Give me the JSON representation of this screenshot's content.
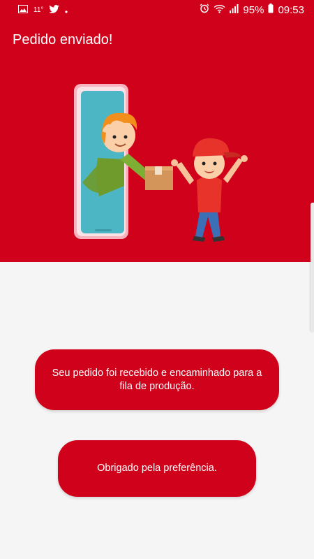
{
  "status_bar": {
    "left_small_text": "11°",
    "battery_percent": "95%",
    "time": "09:53",
    "icons": [
      "gallery-icon",
      "twitter-icon",
      "dot-icon",
      "alarm-icon",
      "wifi-icon",
      "signal-icon",
      "battery-icon"
    ]
  },
  "header": {
    "title": "Pedido enviado!",
    "background_color": "#d0021b"
  },
  "messages": {
    "received": "Seu pedido foi recebido e encaminhado para a fila de produção.",
    "thanks": "Obrigado pela preferência."
  },
  "colors": {
    "accent": "#d0021b",
    "page_background": "#f5f5f5"
  }
}
